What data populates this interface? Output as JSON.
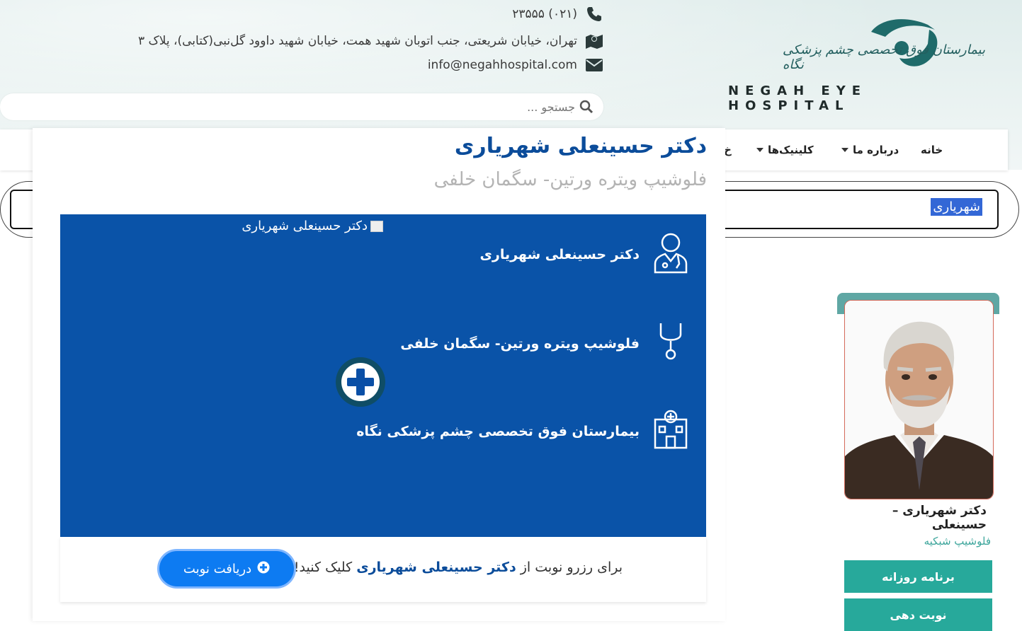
{
  "header": {
    "phone": "(۰۲۱) ۲۳۵۵۵",
    "address": "تهران، خیابان شریعتی، جنب اتوبان شهید همت، خیابان شهید داوود گل‌نبی(کتابی)، پلاک ۳",
    "email": "info@negahhospital.com",
    "logo_en": "NEGAH EYE HOSPITAL",
    "logo_fa": "بیمارستان فوق تخصصی چشم پزشکی نگاه",
    "search_placeholder": "جستجو ..."
  },
  "nav": {
    "items": [
      {
        "label": "خانه",
        "has_caret": false
      },
      {
        "label": "درباره ما",
        "has_caret": true
      },
      {
        "label": "کلینیک‌ها",
        "has_caret": true
      },
      {
        "label": "خ",
        "has_caret": false
      }
    ]
  },
  "search_field": {
    "highlighted_text": "شهریاری"
  },
  "modal": {
    "title": "دکتر حسینعلی شهریاری",
    "subtitle": "فلوشیپ ویتره ورتین- سگمان خلفی",
    "broken_image_alt": "دکتر حسینعلی شهریاری",
    "rows": [
      {
        "icon": "doctor-icon",
        "text": "دکتر حسینعلی شهریاری"
      },
      {
        "icon": "stethoscope-icon",
        "text": "فلوشیپ ویتره ورتین- سگمان خلفی"
      },
      {
        "icon": "hospital-icon",
        "text": "بیمارستان فوق تخصصی چشم پزشکی نگاه"
      }
    ],
    "booking": {
      "prefix": "برای رزرو نوبت از",
      "doctor": "دکتر حسینعلی شهریاری",
      "suffix": "کلیک کنید!",
      "button_label": "دریافت نوبت"
    }
  },
  "side_card": {
    "name": "دکتر شهریاری – حسینعلی",
    "specialty": "فلوشیپ شبکیه",
    "buttons": [
      "برنامه روزانه",
      "نوبت دهی"
    ]
  },
  "colors": {
    "brand_blue": "#0a53a8",
    "title_blue": "#0b4c9a",
    "teal": "#27a99b",
    "button_blue": "#0d7bf2"
  }
}
